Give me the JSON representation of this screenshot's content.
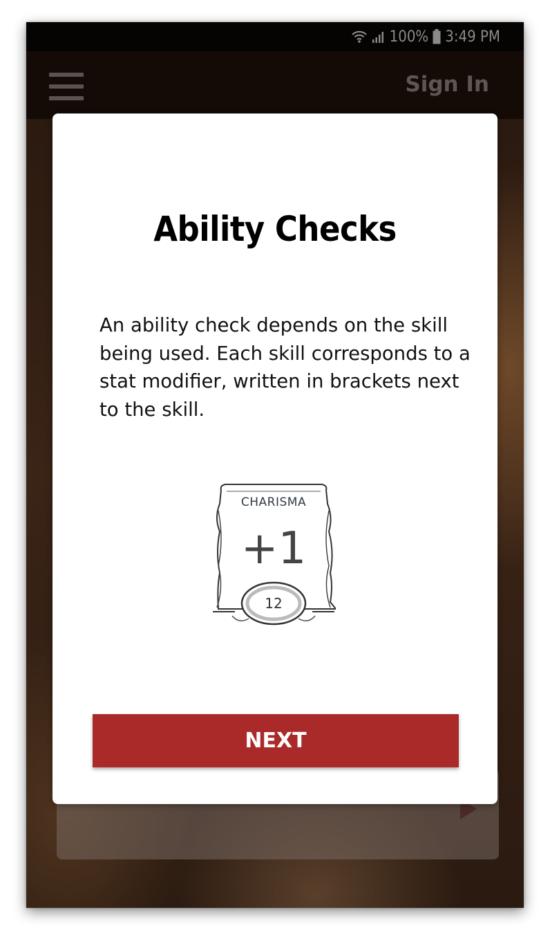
{
  "status_bar": {
    "battery": "100%",
    "time": "3:49 PM"
  },
  "app_bar": {
    "menu_icon": "hamburger-menu-icon",
    "sign_in_label": "Sign In"
  },
  "dialog": {
    "title": "Ability Checks",
    "body": "An ability check depends on the skill being used. Each skill corresponds to a stat modifier, written in brackets next to the skill.",
    "stat_card": {
      "label": "CHARISMA",
      "modifier": "+1",
      "score": "12"
    },
    "next_label": "NEXT"
  },
  "colors": {
    "accent": "#a92a28",
    "app_bar": "#140b07",
    "status_bar": "#050403"
  }
}
